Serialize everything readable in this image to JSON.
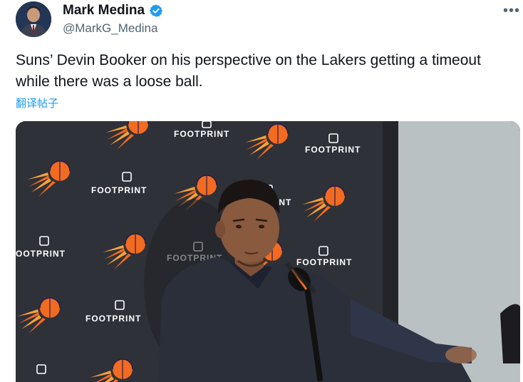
{
  "author": {
    "display_name": "Mark Medina",
    "handle": "@MarkG_Medina",
    "verified": true
  },
  "more_label": "•••",
  "tweet": {
    "text": "Suns’ Devin Booker on his perspective on the Lakers getting a timeout while there was a loose ball.",
    "translate_label": "翻译帖子"
  },
  "media": {
    "backdrop_brand": "FOOTPRINT",
    "partial_texts": [
      "OOTPRINT",
      "TPRINT",
      "NT"
    ],
    "colors": {
      "backdrop": "#2f3138",
      "sun_orange": "#f26b21",
      "sun_purple": "#2b1a4a",
      "wall": "#b9c1c3",
      "shirt": "#2a2f3a",
      "skin": "#8a5a3e"
    }
  },
  "colors": {
    "accent": "#1d9bf0",
    "text": "#0f1419",
    "muted": "#536471"
  }
}
